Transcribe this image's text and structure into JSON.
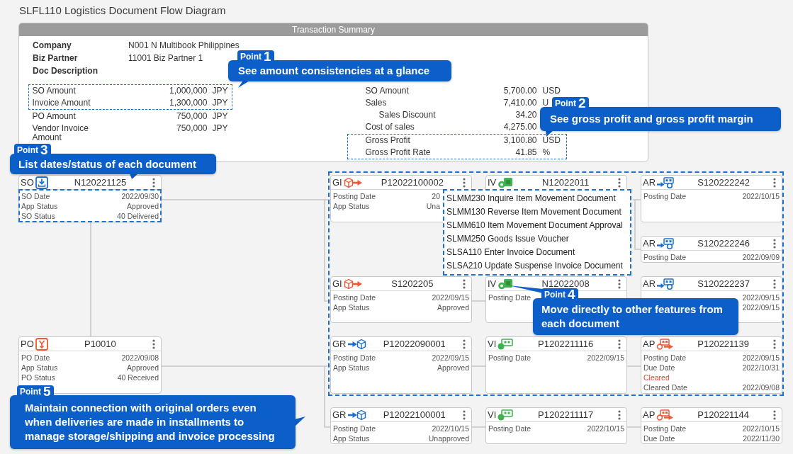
{
  "title": "SLFL110 Logistics Document Flow Diagram",
  "summary": {
    "title": "Transaction Summary",
    "info": [
      {
        "label": "Company",
        "value": "N001 N Multibook Philippines"
      },
      {
        "label": "Biz Partner",
        "value": "11001 Biz Partner 1"
      },
      {
        "label": "Doc Description"
      }
    ],
    "left_groups": [
      {
        "highlighted": true,
        "rows": [
          {
            "label": "SO Amount",
            "value": "1,000,000",
            "currency": "JPY"
          },
          {
            "label": "Invoice Amount",
            "value": "1,300,000",
            "currency": "JPY"
          }
        ]
      },
      {
        "highlighted": false,
        "rows": [
          {
            "label": "PO Amount",
            "value": "750,000",
            "currency": "JPY"
          },
          {
            "label": "Vendor Invoice Amount",
            "value": "750,000",
            "currency": "JPY"
          }
        ]
      }
    ],
    "right_groups": [
      {
        "highlighted": false,
        "rows": [
          {
            "label": "SO Amount",
            "value": "5,700.00",
            "currency": "USD"
          },
          {
            "label": "Sales",
            "value": "7,410.00",
            "currency": "U",
            "children": [
              {
                "label": "Sales Discount",
                "value": "34.20"
              }
            ]
          },
          {
            "label": "Cost of sales",
            "value": "4,275.00"
          }
        ]
      },
      {
        "highlighted": true,
        "rows": [
          {
            "label": "Gross Profit",
            "value": "3,100.80",
            "currency": "USD"
          },
          {
            "label": "Gross Profit Rate",
            "value": "41.85",
            "currency": "%"
          }
        ]
      }
    ]
  },
  "flow": {
    "rows": [
      {
        "cards": [
          {
            "kind": "sales_order",
            "code": "SO",
            "number": "N120221125",
            "highlighted": true,
            "fields": [
              {
                "kind": "pair",
                "label": "SO Date",
                "value": "2022/09/30"
              },
              {
                "kind": "pair",
                "label": "App Status",
                "value": "Approved"
              },
              {
                "kind": "pair",
                "label": "SO Status",
                "value": "40 Delivered"
              }
            ]
          },
          {
            "kind": "goods_issue",
            "code": "GI",
            "number": "P12022100002",
            "highlighted": false,
            "fields": [
              {
                "kind": "clipped",
                "label": "Posting Date",
                "value": "20"
              },
              {
                "kind": "clipped",
                "label": "App Status",
                "value": "Una"
              }
            ]
          },
          {
            "kind": "invoice",
            "code": "IV",
            "number": "N12022011",
            "highlighted": false,
            "menu": [
              "SLMM230 Inquire Item Movement Document",
              "SLMM130 Reverse Item Movement Document",
              "SLMM610 Item Movement Document Approval",
              "SLMM250 Goods Issue Voucher",
              "SLSA110 Enter Invoice Document",
              "SLSA210 Update Suspense Invoice Document"
            ]
          },
          {
            "kind": "receivable",
            "code": "AR",
            "number": "S120222242",
            "highlighted": false,
            "fields": [
              {
                "kind": "pair",
                "label": "Posting Date",
                "value": "2022/10/15"
              }
            ]
          }
        ]
      },
      {
        "cards": [
          {
            "kind": "receivable",
            "code": "AR",
            "number": "S120222246",
            "highlighted": false,
            "fields": [
              {
                "kind": "pair",
                "label": "Posting Date",
                "value": "2022/09/09"
              }
            ]
          }
        ]
      },
      {
        "cards": [
          {
            "kind": "goods_issue",
            "code": "GI",
            "number": "S1202205",
            "highlighted": false,
            "fields": [
              {
                "kind": "pair",
                "label": "Posting Date",
                "value": "2022/09/15"
              },
              {
                "kind": "pair",
                "label": "App Status",
                "value": "Approved"
              }
            ]
          },
          {
            "kind": "invoice",
            "code": "IV",
            "number": "N12022008",
            "highlighted": false,
            "fields": [
              {
                "kind": "pair",
                "label": "Posting Date"
              }
            ]
          },
          {
            "kind": "receivable",
            "code": "AR",
            "number": "S120222237",
            "highlighted": false,
            "fields": [
              {
                "kind": "pair",
                "value": "2022/09/15"
              },
              {
                "kind": "pair",
                "value": "2022/09/15"
              }
            ]
          }
        ]
      },
      {
        "cards": [
          {
            "kind": "purchase_order",
            "code": "PO",
            "number": "P10010",
            "highlighted": false,
            "fields": [
              {
                "kind": "pair",
                "label": "PO Date",
                "value": "2022/09/08"
              },
              {
                "kind": "pair",
                "label": "App Status",
                "value": "Approved"
              },
              {
                "kind": "pair",
                "label": "PO Status",
                "value": "40 Received"
              }
            ]
          },
          {
            "kind": "goods_receipt",
            "code": "GR",
            "number": "P12022090001",
            "highlighted": false,
            "fields": [
              {
                "kind": "pair",
                "label": "Posting Date",
                "value": "2022/09/15"
              },
              {
                "kind": "pair",
                "label": "App Status",
                "value": "Approved"
              }
            ]
          },
          {
            "kind": "vendor_invoice",
            "code": "VI",
            "number": "P1202211116",
            "highlighted": false,
            "fields": [
              {
                "kind": "pair",
                "label": "Posting Date",
                "value": "2022/09/15"
              }
            ]
          },
          {
            "kind": "payable",
            "code": "AP",
            "number": "P120221139",
            "highlighted": false,
            "fields": [
              {
                "kind": "pair",
                "label": "Posting Date",
                "value": "2022/09/15"
              },
              {
                "kind": "pair",
                "label": "Due Date",
                "value": "2022/10/31"
              },
              {
                "kind": "status",
                "label": "Cleared"
              },
              {
                "kind": "pair",
                "label": "Cleared Date",
                "value": "2022/09/08"
              }
            ]
          }
        ]
      },
      {
        "cards": [
          {
            "kind": "goods_receipt",
            "code": "GR",
            "number": "P12022100001",
            "highlighted": false,
            "fields": [
              {
                "kind": "pair",
                "label": "Posting Date",
                "value": "2022/10/15"
              },
              {
                "kind": "pair",
                "label": "App Status",
                "value": "Unapproved"
              }
            ]
          },
          {
            "kind": "vendor_invoice",
            "code": "VI",
            "number": "P1202211117",
            "highlighted": false,
            "fields": [
              {
                "kind": "pair",
                "label": "Posting Date",
                "value": "2022/10/15"
              }
            ]
          },
          {
            "kind": "payable",
            "code": "AP",
            "number": "P120221144",
            "highlighted": false,
            "fields": [
              {
                "kind": "pair",
                "label": "Posting Date",
                "value": "2022/10/15"
              },
              {
                "kind": "pair",
                "label": "Due Date",
                "value": "2022/11/30"
              }
            ]
          }
        ]
      }
    ]
  },
  "callouts": [
    {
      "tag": "Point",
      "number": "1",
      "text": "See amount consistencies at a glance"
    },
    {
      "tag": "Point",
      "number": "2",
      "text": "See gross profit and gross profit margin"
    },
    {
      "tag": "Point",
      "number": "3",
      "text": "List dates/status of each document"
    },
    {
      "tag": "Point",
      "number": "4",
      "text": "Move directly to other features from each document"
    },
    {
      "tag": "Point",
      "number": "5",
      "text": "Maintain connection with original orders even when deliveries are made in installments to manage storage/shipping and invoice processing"
    }
  ]
}
